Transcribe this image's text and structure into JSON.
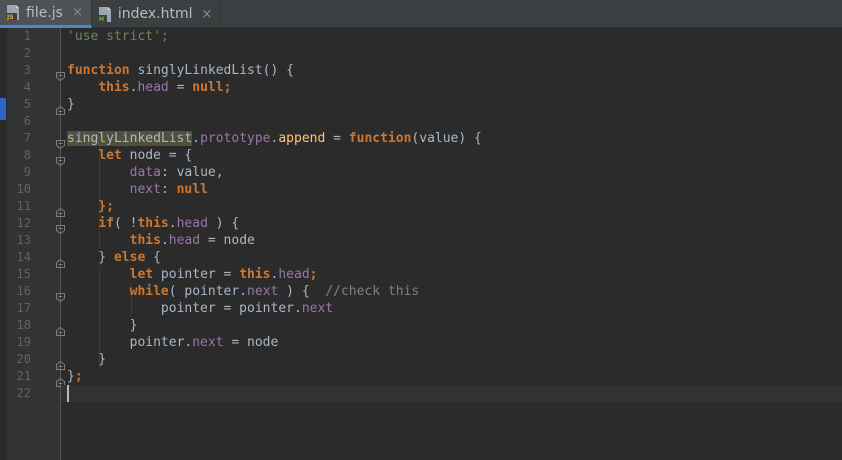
{
  "tabs": [
    {
      "label": "file.js",
      "icon": "javascript-file-icon",
      "active": true,
      "close": "×"
    },
    {
      "label": "index.html",
      "icon": "html-file-icon",
      "active": false,
      "close": "×"
    }
  ],
  "colors": {
    "background": "#2b2b2b",
    "gutter": "#313335",
    "keyword": "#cc7832",
    "string": "#6a8759",
    "property": "#9876aa",
    "comment": "#808080",
    "default_text": "#a9b7c6",
    "identifier_highlight": "#52503a"
  },
  "editor": {
    "line_numbers": [
      "1",
      "2",
      "3",
      "4",
      "5",
      "6",
      "7",
      "8",
      "9",
      "10",
      "11",
      "12",
      "13",
      "14",
      "15",
      "16",
      "17",
      "18",
      "19",
      "20",
      "21",
      "22"
    ],
    "current_line": "22",
    "lines": [
      [
        {
          "t": "'use strict';",
          "c": "str"
        }
      ],
      [],
      [
        {
          "t": "function",
          "c": "kw"
        },
        {
          "t": " singlyLinkedList() {",
          "c": ""
        }
      ],
      [
        {
          "t": "    ",
          "c": ""
        },
        {
          "t": "this",
          "c": "kw"
        },
        {
          "t": ".",
          "c": ""
        },
        {
          "t": "head",
          "c": "prop"
        },
        {
          "t": " = ",
          "c": ""
        },
        {
          "t": "null",
          "c": "kw"
        },
        {
          "t": ";",
          "c": "kw"
        }
      ],
      [
        {
          "t": "}",
          "c": ""
        }
      ],
      [],
      [
        {
          "t": "singlyLinkedList",
          "c": "hl"
        },
        {
          "t": ".",
          "c": ""
        },
        {
          "t": "prototype",
          "c": "prop"
        },
        {
          "t": ".",
          "c": ""
        },
        {
          "t": "append",
          "c": "fn"
        },
        {
          "t": " = ",
          "c": ""
        },
        {
          "t": "function",
          "c": "kw"
        },
        {
          "t": "(value) {",
          "c": ""
        }
      ],
      [
        {
          "t": "    ",
          "c": ""
        },
        {
          "t": "let",
          "c": "kw"
        },
        {
          "t": " node = {",
          "c": ""
        }
      ],
      [
        {
          "t": "        ",
          "c": ""
        },
        {
          "t": "data",
          "c": "prop"
        },
        {
          "t": ": value,",
          "c": ""
        }
      ],
      [
        {
          "t": "        ",
          "c": ""
        },
        {
          "t": "next",
          "c": "prop"
        },
        {
          "t": ": ",
          "c": ""
        },
        {
          "t": "null",
          "c": "kw"
        }
      ],
      [
        {
          "t": "    };",
          "c": "kw"
        }
      ],
      [
        {
          "t": "    ",
          "c": ""
        },
        {
          "t": "if",
          "c": "kw"
        },
        {
          "t": "( !",
          "c": ""
        },
        {
          "t": "this",
          "c": "kw"
        },
        {
          "t": ".",
          "c": ""
        },
        {
          "t": "head",
          "c": "prop"
        },
        {
          "t": " ) {",
          "c": ""
        }
      ],
      [
        {
          "t": "        ",
          "c": ""
        },
        {
          "t": "this",
          "c": "kw"
        },
        {
          "t": ".",
          "c": ""
        },
        {
          "t": "head",
          "c": "prop"
        },
        {
          "t": " = node",
          "c": ""
        }
      ],
      [
        {
          "t": "    } ",
          "c": ""
        },
        {
          "t": "else",
          "c": "kw"
        },
        {
          "t": " {",
          "c": ""
        }
      ],
      [
        {
          "t": "        ",
          "c": ""
        },
        {
          "t": "let",
          "c": "kw"
        },
        {
          "t": " pointer = ",
          "c": ""
        },
        {
          "t": "this",
          "c": "kw"
        },
        {
          "t": ".",
          "c": ""
        },
        {
          "t": "head",
          "c": "prop"
        },
        {
          "t": ";",
          "c": "kw"
        }
      ],
      [
        {
          "t": "        ",
          "c": ""
        },
        {
          "t": "while",
          "c": "kw"
        },
        {
          "t": "( pointer.",
          "c": ""
        },
        {
          "t": "next",
          "c": "prop"
        },
        {
          "t": " ) {  ",
          "c": ""
        },
        {
          "t": "//check this",
          "c": "cmt"
        }
      ],
      [
        {
          "t": "            pointer = pointer.",
          "c": ""
        },
        {
          "t": "next",
          "c": "prop"
        }
      ],
      [
        {
          "t": "        }",
          "c": ""
        }
      ],
      [
        {
          "t": "        pointer.",
          "c": ""
        },
        {
          "t": "next",
          "c": "prop"
        },
        {
          "t": " = node",
          "c": ""
        }
      ],
      [
        {
          "t": "    }",
          "c": ""
        }
      ],
      [
        {
          "t": "}",
          "c": ""
        },
        {
          "t": ";",
          "c": "kw"
        }
      ],
      []
    ]
  }
}
